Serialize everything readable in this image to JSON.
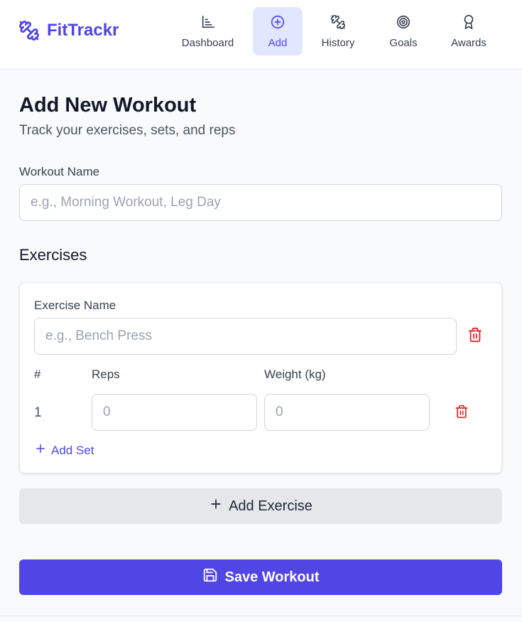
{
  "app": {
    "name": "FitTrackr",
    "brand_color": "#4f46e5",
    "logo_icon": "dumbbell-icon"
  },
  "nav": [
    {
      "label": "Dashboard",
      "icon": "bar-chart-icon",
      "active": false
    },
    {
      "label": "Add",
      "icon": "plus-circle-icon",
      "active": true
    },
    {
      "label": "History",
      "icon": "dumbbell-icon",
      "active": false
    },
    {
      "label": "Goals",
      "icon": "target-icon",
      "active": false
    },
    {
      "label": "Awards",
      "icon": "award-icon",
      "active": false
    }
  ],
  "page": {
    "title": "Add New Workout",
    "subtitle": "Track your exercises, sets, and reps"
  },
  "workout": {
    "name_label": "Workout Name",
    "name_value": "",
    "name_placeholder": "e.g., Morning Workout, Leg Day"
  },
  "exercises": {
    "section_title": "Exercises",
    "exercise_name_label": "Exercise Name",
    "exercise_name_value": "",
    "exercise_name_placeholder": "e.g., Bench Press",
    "columns": {
      "number": "#",
      "reps": "Reps",
      "weight": "Weight (kg)"
    },
    "sets": [
      {
        "number": "1",
        "reps_placeholder": "0",
        "weight_placeholder": "0"
      }
    ],
    "add_set_label": "Add Set",
    "delete_color": "#dc2626"
  },
  "actions": {
    "add_exercise_label": "Add Exercise",
    "save_label": "Save Workout"
  }
}
